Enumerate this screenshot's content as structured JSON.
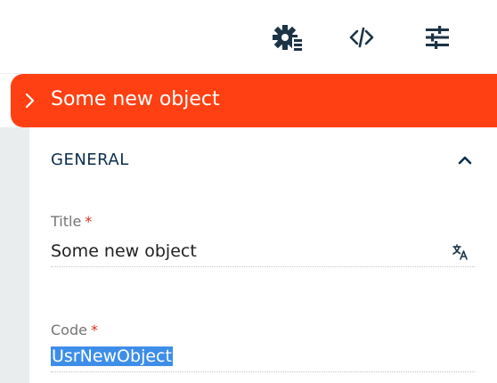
{
  "toolbar": {
    "buttons": [
      {
        "icon": "settings-gear-icon"
      },
      {
        "icon": "code-icon"
      },
      {
        "icon": "tune-sliders-icon"
      }
    ],
    "icon_color": "#1d3346"
  },
  "object": {
    "name": "Some new object",
    "header_color": "#ff4013"
  },
  "section": {
    "title": "GENERAL",
    "expanded": true
  },
  "fields": {
    "title": {
      "label": "Title",
      "required_mark": "*",
      "value": "Some new object",
      "action_icon": "translate-icon"
    },
    "code": {
      "label": "Code",
      "required_mark": "*",
      "value": "UsrNewObject",
      "selected": true
    }
  }
}
